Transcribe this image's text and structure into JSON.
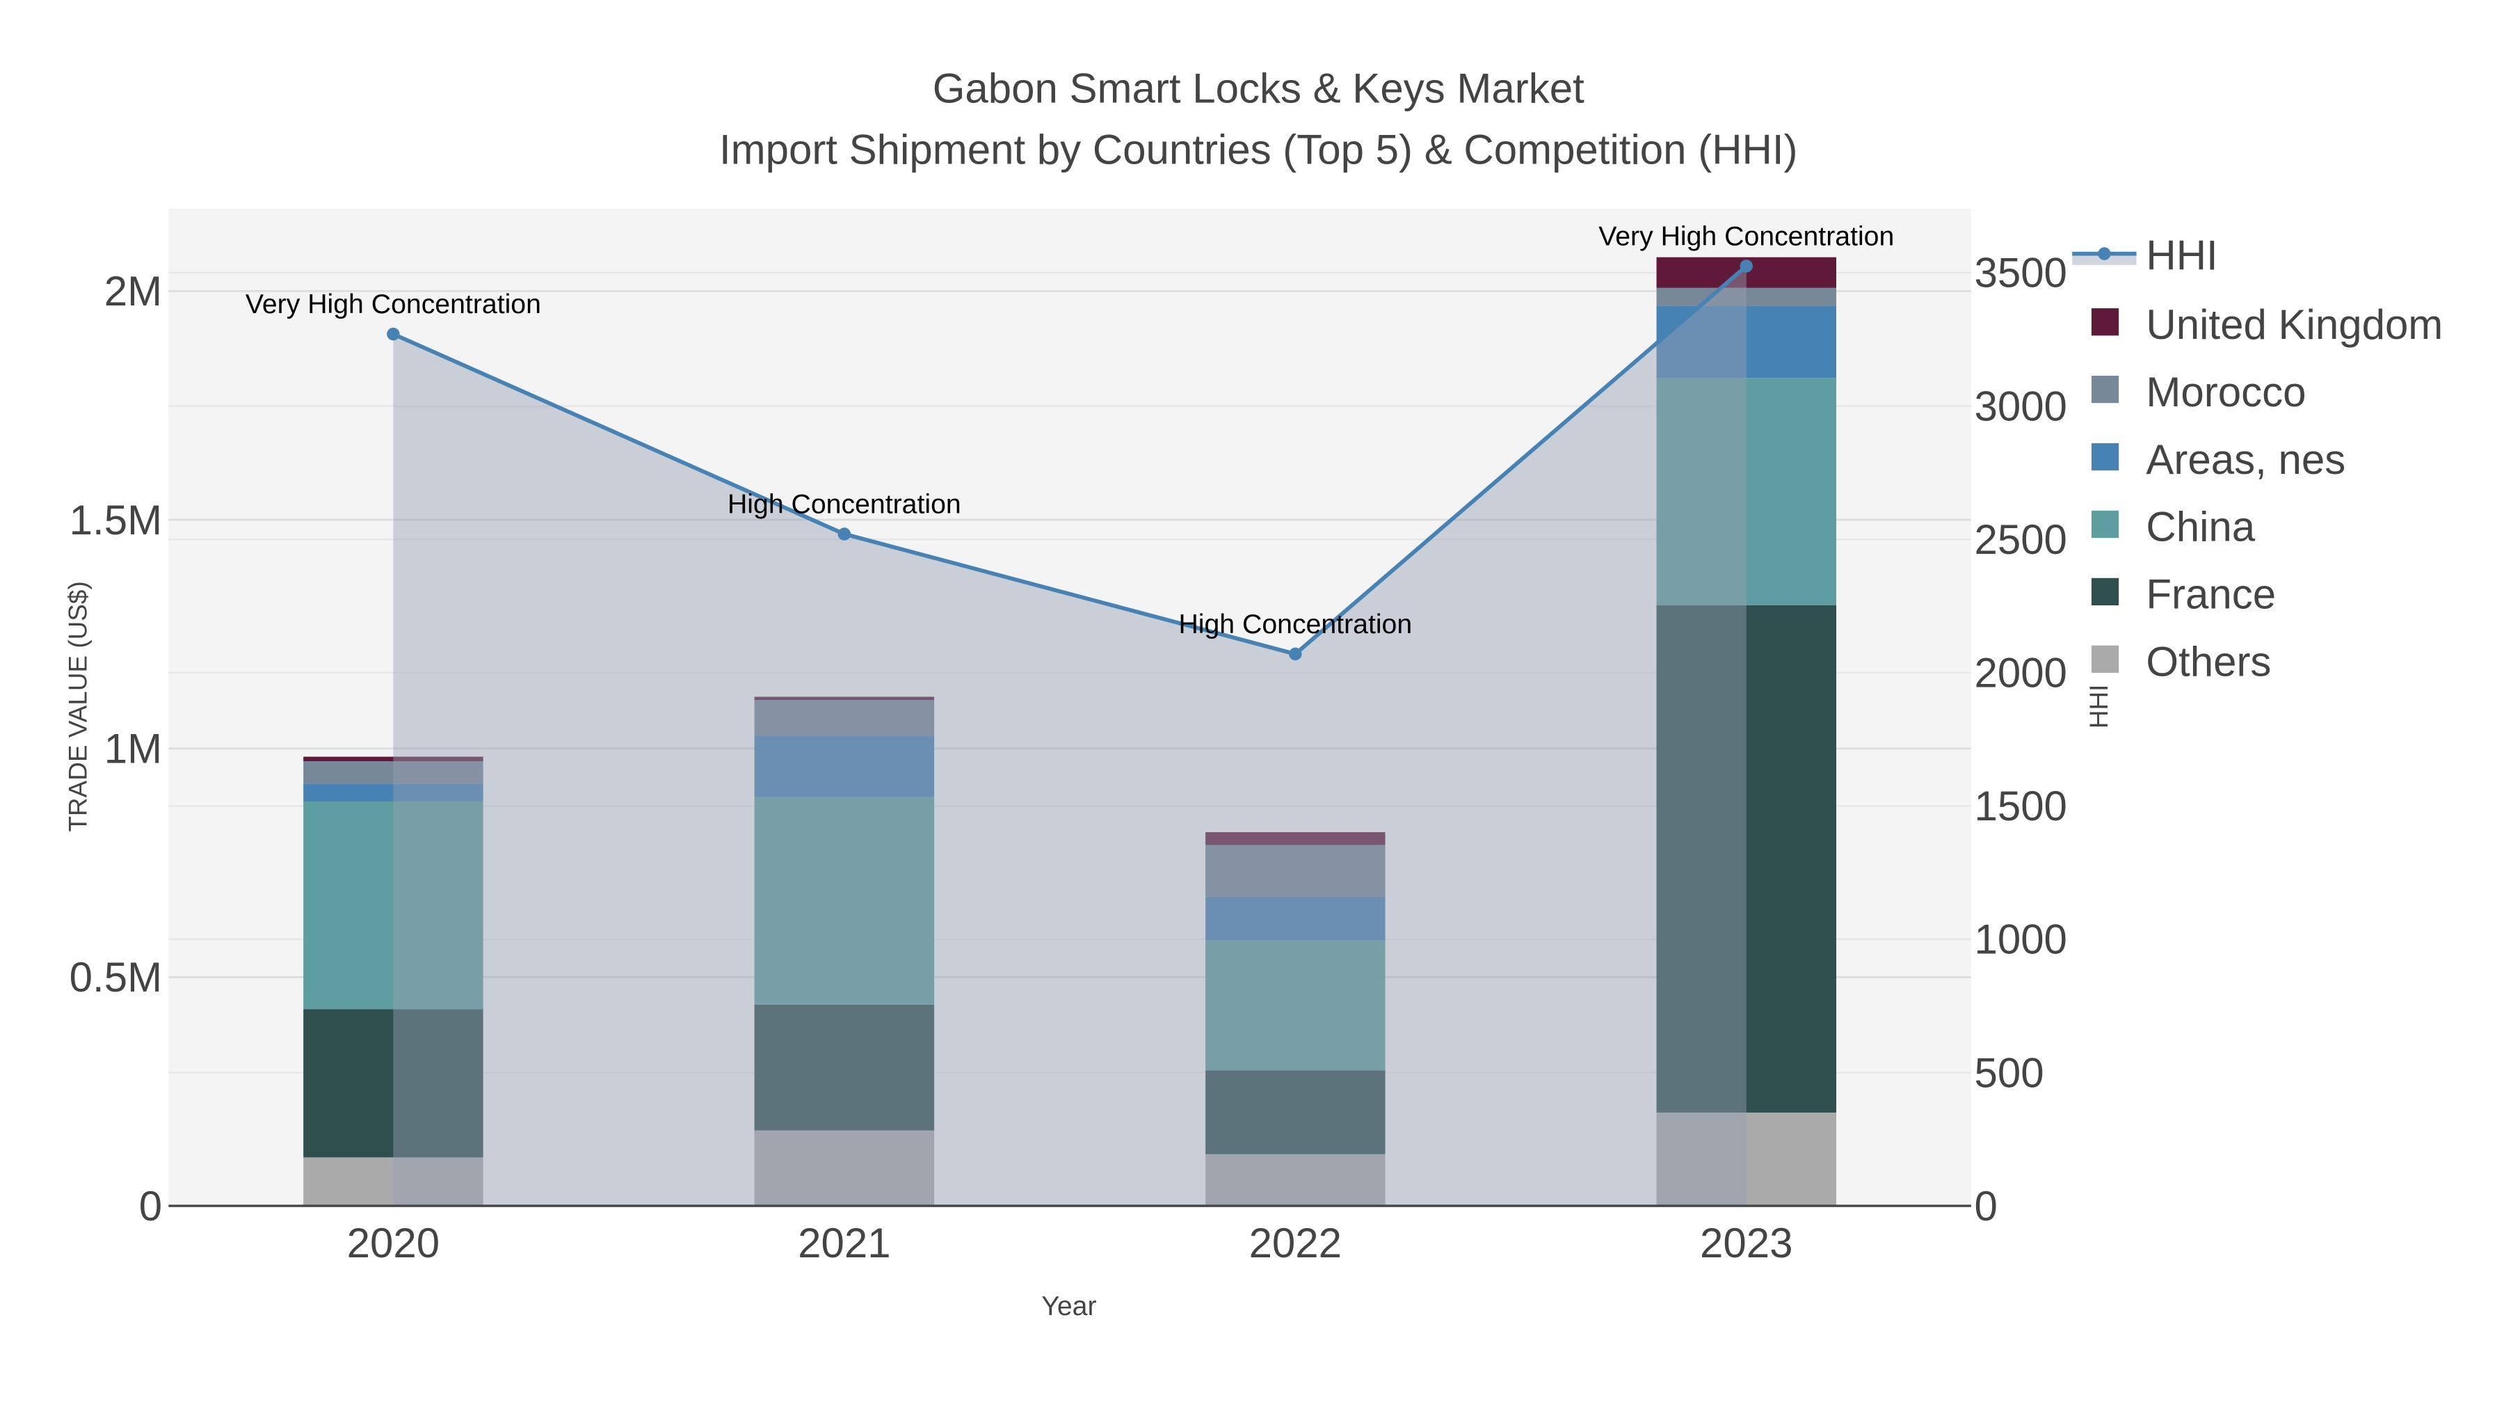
{
  "chart_data": {
    "type": "bar",
    "title": "Gabon Smart Locks & Keys Market",
    "subtitle": "Import Shipment by Countries (Top 5) & Competition (HHI)",
    "xlabel": "Year",
    "ylabel": "TRADE VALUE (US$)",
    "y2label": "HHI",
    "categories": [
      "2020",
      "2021",
      "2022",
      "2023"
    ],
    "ylim": [
      0,
      2180000
    ],
    "y2lim": [
      0,
      3740
    ],
    "yticks": [
      {
        "v": 0,
        "label": "0"
      },
      {
        "v": 500000,
        "label": "0.5M"
      },
      {
        "v": 1000000,
        "label": "1M"
      },
      {
        "v": 1500000,
        "label": "1.5M"
      },
      {
        "v": 2000000,
        "label": "2M"
      }
    ],
    "y2ticks": [
      {
        "v": 0,
        "label": "0"
      },
      {
        "v": 500,
        "label": "500"
      },
      {
        "v": 1000,
        "label": "1000"
      },
      {
        "v": 1500,
        "label": "1500"
      },
      {
        "v": 2000,
        "label": "2000"
      },
      {
        "v": 2500,
        "label": "2500"
      },
      {
        "v": 3000,
        "label": "3000"
      },
      {
        "v": 3500,
        "label": "3500"
      }
    ],
    "series": [
      {
        "name": "Others",
        "color": "#aaaaaa",
        "values": [
          106000,
          165000,
          113000,
          204000
        ]
      },
      {
        "name": "France",
        "color": "#2f4f4f",
        "values": [
          324000,
          275000,
          183000,
          1109000
        ]
      },
      {
        "name": "China",
        "color": "#5f9ea0",
        "values": [
          454000,
          454000,
          285000,
          497000
        ]
      },
      {
        "name": "Areas, nes",
        "color": "#4682b4",
        "values": [
          39000,
          134000,
          95000,
          158000
        ]
      },
      {
        "name": "Morocco",
        "color": "#778899",
        "values": [
          49000,
          78000,
          113000,
          39000
        ]
      },
      {
        "name": "United Kingdom",
        "color": "#5f1a3a",
        "values": [
          10000,
          7000,
          28000,
          67000
        ]
      }
    ],
    "hhi": {
      "name": "HHI",
      "color": "#4682b4",
      "values": [
        3270,
        2520,
        2070,
        3525
      ],
      "annotations": [
        "Very High Concentration",
        "High Concentration",
        "High Concentration",
        "Very High Concentration"
      ]
    },
    "legend": "right"
  }
}
